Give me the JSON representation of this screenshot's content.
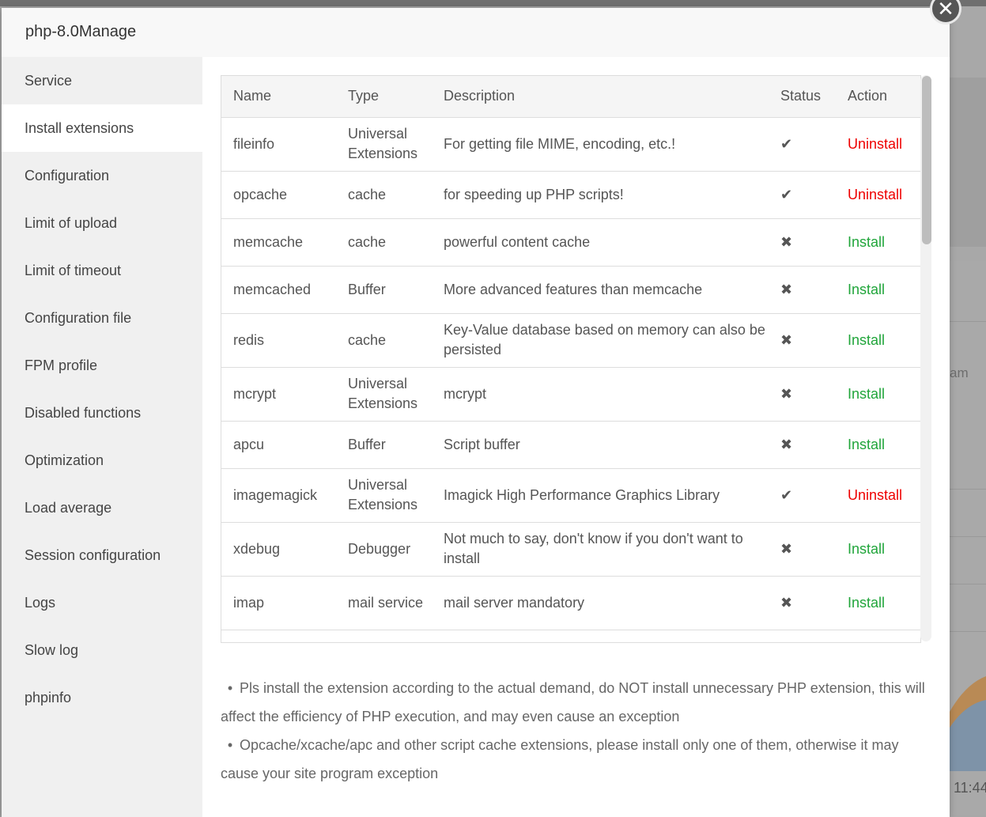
{
  "modal": {
    "title": "php-8.0Manage",
    "close_glyph": "✕"
  },
  "sidebar": {
    "items": [
      {
        "label": "Service"
      },
      {
        "label": "Install extensions",
        "active": true
      },
      {
        "label": "Configuration"
      },
      {
        "label": "Limit of upload"
      },
      {
        "label": "Limit of timeout"
      },
      {
        "label": "Configuration file"
      },
      {
        "label": "FPM profile"
      },
      {
        "label": "Disabled functions"
      },
      {
        "label": "Optimization"
      },
      {
        "label": "Load average"
      },
      {
        "label": "Session configuration"
      },
      {
        "label": "Logs"
      },
      {
        "label": "Slow log"
      },
      {
        "label": "phpinfo"
      }
    ]
  },
  "table": {
    "headers": {
      "name": "Name",
      "type": "Type",
      "description": "Description",
      "status": "Status",
      "action": "Action"
    },
    "rows": [
      {
        "name": "fileinfo",
        "type": "Universal Extensions",
        "description": "For getting file MIME, encoding, etc.!",
        "status": "✔",
        "installed": true,
        "action": "Uninstall"
      },
      {
        "name": "opcache",
        "type": "cache",
        "description": "for speeding up PHP scripts!",
        "status": "✔",
        "installed": true,
        "action": "Uninstall"
      },
      {
        "name": "memcache",
        "type": "cache",
        "description": "powerful content cache",
        "status": "✖",
        "installed": false,
        "action": "Install"
      },
      {
        "name": "memcached",
        "type": "Buffer",
        "description": "More advanced features than memcache",
        "status": "✖",
        "installed": false,
        "action": "Install"
      },
      {
        "name": "redis",
        "type": "cache",
        "description": "Key-Value database based on memory can also be persisted",
        "status": "✖",
        "installed": false,
        "action": "Install"
      },
      {
        "name": "mcrypt",
        "type": "Universal Extensions",
        "description": "mcrypt",
        "status": "✖",
        "installed": false,
        "action": "Install"
      },
      {
        "name": "apcu",
        "type": "Buffer",
        "description": "Script buffer",
        "status": "✖",
        "installed": false,
        "action": "Install"
      },
      {
        "name": "imagemagick",
        "type": "Universal Extensions",
        "description": "Imagick High Performance Graphics Library",
        "status": "✔",
        "installed": true,
        "action": "Uninstall"
      },
      {
        "name": "xdebug",
        "type": "Debugger",
        "description": "Not much to say, don't know if you don't want to install",
        "status": "✖",
        "installed": false,
        "action": "Install"
      },
      {
        "name": "imap",
        "type": "mail service",
        "description": "mail server mandatory",
        "status": "✖",
        "installed": false,
        "action": "Install"
      }
    ]
  },
  "notes": {
    "bullet": "•",
    "items": [
      "Pls install the extension according to the actual demand, do NOT install unnecessary PHP extension, this will affect the efficiency of PHP execution, and may even cause an exception",
      "Opcache/xcache/apc and other script cache extensions, please install only one of them, otherwise it may cause your site program exception"
    ]
  },
  "background": {
    "fragment_text": "am",
    "time_fragment": "11:44"
  },
  "colors": {
    "install": "#20a53a",
    "uninstall": "#e00000"
  }
}
